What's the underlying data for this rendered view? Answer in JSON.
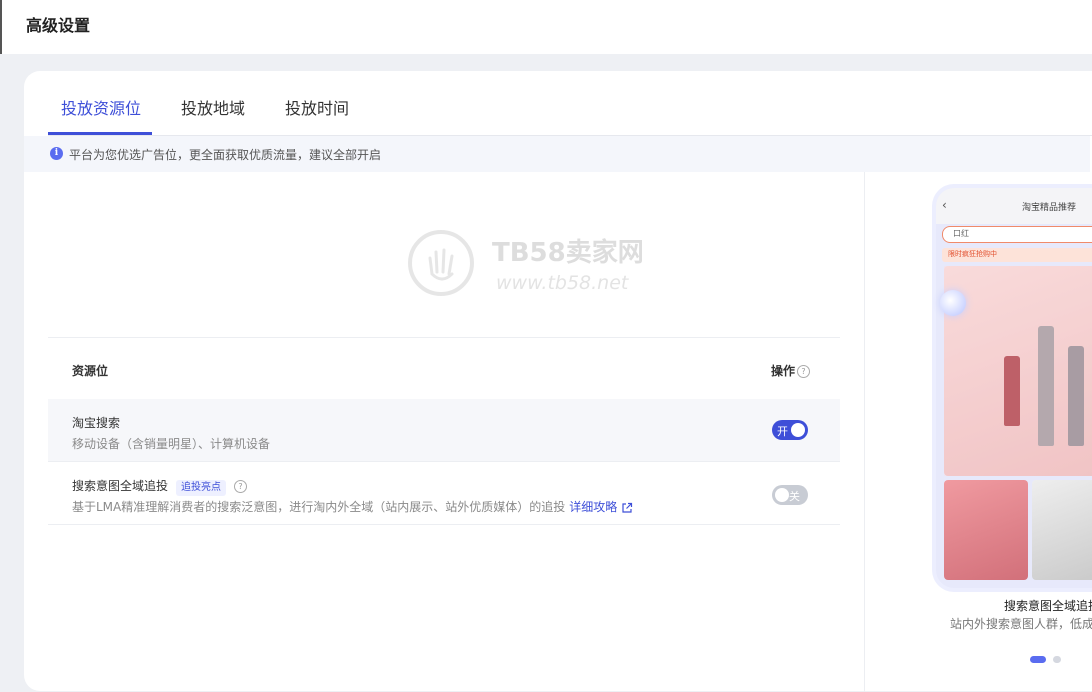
{
  "header": {
    "title": "高级设置"
  },
  "tabs": [
    {
      "label": "投放资源位",
      "active": true
    },
    {
      "label": "投放地域",
      "active": false
    },
    {
      "label": "投放时间",
      "active": false
    }
  ],
  "notice": {
    "text": "平台为您优选广告位，更全面获取优质流量，建议全部开启"
  },
  "watermark": {
    "brand": "TB58卖家网",
    "url": "www.tb58.net"
  },
  "table": {
    "col_resource": "资源位",
    "col_action": "操作",
    "rows": [
      {
        "name": "淘宝搜索",
        "desc": "移动设备（含销量明星）、计算机设备",
        "toggle_label": "开",
        "enabled": true
      },
      {
        "name": "搜索意图全域追投",
        "badge": "追投亮点",
        "desc": "基于LMA精准理解消费者的搜索泛意图，进行淘内外全域（站内展示、站外优质媒体）的追投",
        "link": "详细攻略",
        "toggle_label": "关",
        "enabled": false
      }
    ]
  },
  "preview": {
    "phone_title": "淘宝精品推荐",
    "search_text": "口红",
    "banner_text": "限时疯狂抢购中",
    "caption_title": "搜索意图全域追投",
    "caption_desc": "站内外搜索意图人群，低成"
  },
  "colors": {
    "accent": "#3e4fd8",
    "toggle_off": "#c8ccd4"
  }
}
